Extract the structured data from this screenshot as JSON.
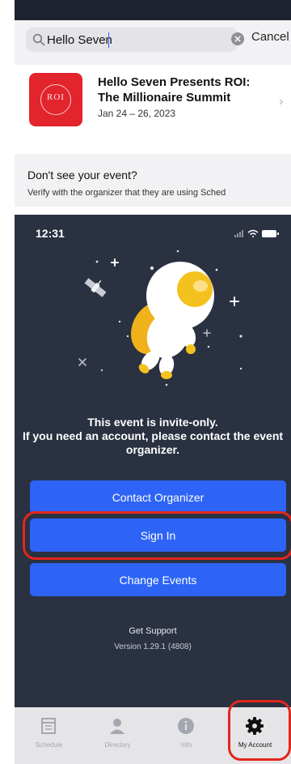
{
  "search_screen": {
    "query": "Hello Seven",
    "cancel_label": "Cancel",
    "result": {
      "title": "Hello Seven Presents ROI: The Millionaire Summit",
      "date": "Jan 24 – 26, 2023",
      "thumb_text": "ROI",
      "chevron": "›"
    },
    "dont_see_title": "Don't see your event?",
    "dont_see_hint": "Verify with the organizer that they are using Sched"
  },
  "app_screen": {
    "status_time": "12:31",
    "invite_message": "This event is invite-only.\nIf you need an account, please contact the event organizer.",
    "buttons": {
      "contact": "Contact Organizer",
      "sign_in": "Sign In",
      "change_events": "Change Events"
    },
    "get_support": "Get Support",
    "version": "Version 1.29.1 (4808)",
    "tabs": [
      {
        "label": "Schedule",
        "icon": "calendar-icon"
      },
      {
        "label": "Directory",
        "icon": "person-icon"
      },
      {
        "label": "Info",
        "icon": "info-icon"
      },
      {
        "label": "My Account",
        "icon": "gear-icon"
      }
    ],
    "active_tab": "My Account"
  },
  "colors": {
    "accent_blue": "#2d64f5",
    "dark_bg": "#2a3141",
    "highlight_red": "#e3261b",
    "thumb_red": "#e2242d"
  }
}
